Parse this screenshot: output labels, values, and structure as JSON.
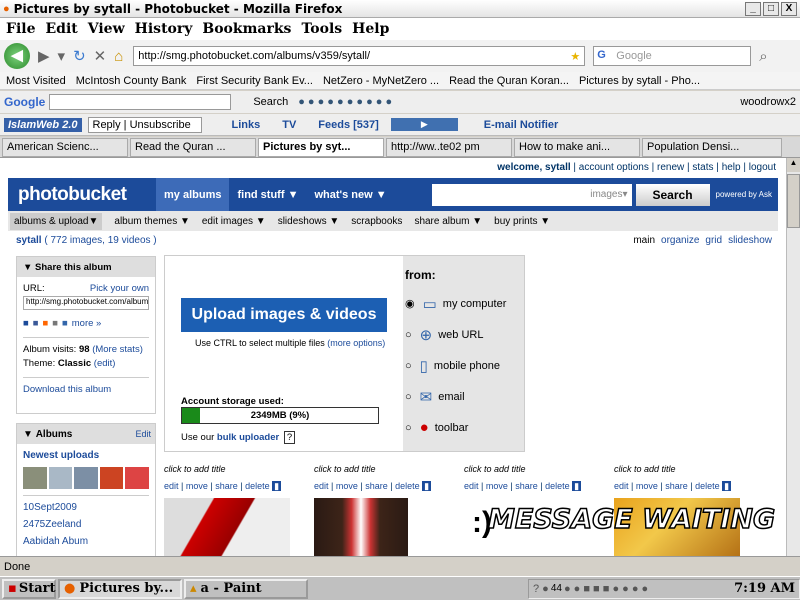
{
  "window": {
    "title": "Pictures by sytall - Photobucket - Mozilla Firefox",
    "controls": [
      "_",
      "□",
      "X"
    ]
  },
  "menu": [
    "File",
    "Edit",
    "View",
    "History",
    "Bookmarks",
    "Tools",
    "Help"
  ],
  "nav": {
    "url": "http://smg.photobucket.com/albums/v359/sytall/",
    "search_placeholder": "Google"
  },
  "bookmarks": [
    "Most Visited",
    "McIntosh County Bank",
    "First Security Bank Ev...",
    "NetZero - MyNetZero ...",
    "Read the Quran Koran...",
    "Pictures by sytall - Pho..."
  ],
  "google_toolbar": {
    "search_label": "Search",
    "user": "woodrowx2"
  },
  "islam_toolbar": {
    "logo": "IslamWeb 2.0",
    "select": "Reply | Unsubscribe",
    "links": "Links",
    "tv": "TV",
    "feeds": "Feeds [537]",
    "email": "E-mail Notifier"
  },
  "tabs": [
    "American Scienc...",
    "Read the Quran ...",
    "Pictures by syt...",
    "http://ww..te02 pm",
    "How to make ani...",
    "Population Densi..."
  ],
  "photobucket": {
    "top_links": [
      "welcome, sytall",
      "account options",
      "renew",
      "stats",
      "help",
      "logout"
    ],
    "logo": "photobucket",
    "nav": [
      "my albums",
      "find stuff ▼",
      "what's new ▼"
    ],
    "search_dropdown": "images",
    "search_button": "Search",
    "powered_by": "powered by Ask",
    "subnav": [
      "albums & upload▼",
      "album themes ▼",
      "edit images ▼",
      "slideshows ▼",
      "scrapbooks",
      "share album ▼",
      "buy prints ▼"
    ],
    "user": {
      "name": "sytall",
      "counts": "( 772 images, 19 videos )"
    },
    "views": [
      "main",
      "organize",
      "grid",
      "slideshow"
    ],
    "share": {
      "heading": "Share this album",
      "url_label": "URL:",
      "pick_icon": "Pick your own",
      "url_value": "http://smg.photobucket.com/album",
      "more": "more »",
      "visits_label": "Album visits:",
      "visits": "98",
      "more_stats": "(More stats)",
      "theme_label": "Theme:",
      "theme": "Classic",
      "edit": "(edit)",
      "download": "Download this album"
    },
    "albums": {
      "heading": "Albums",
      "edit": "Edit",
      "newest": "Newest uploads",
      "list": [
        "10Sept2009",
        "2475Zeeland",
        "Aabidah Abum"
      ]
    },
    "upload": {
      "button": "Upload images & videos",
      "hint": "Use CTRL to select multiple files",
      "more_options": "(more options)",
      "storage_label": "Account storage used:",
      "storage_text": "2349MB (9%)",
      "storage_fraction": 0.09,
      "bulk_prefix": "Use our",
      "bulk_link": "bulk uploader",
      "help": "?",
      "from_label": "from:",
      "sources": [
        "my computer",
        "web URL",
        "mobile phone",
        "email",
        "toolbar"
      ]
    },
    "thumbs": {
      "title": "click to add title",
      "actions": [
        "edit",
        "move",
        "share",
        "delete"
      ],
      "overlay": "MESSAGE WAITING"
    }
  },
  "status": "Done",
  "taskbar": {
    "start": "Start",
    "items": [
      "Pictures by...",
      "a - Paint"
    ],
    "time": "7:19 AM",
    "temp": "44"
  }
}
